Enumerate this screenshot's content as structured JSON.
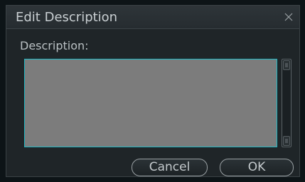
{
  "dialog": {
    "title": "Edit Description",
    "close_icon": "close-icon",
    "description_label": "Description:",
    "description_value": "",
    "cancel_label": "Cancel",
    "ok_label": "OK"
  },
  "colors": {
    "dialog_bg": "#1f2528",
    "textarea_bg": "#7c7c7c",
    "textarea_border": "#1fb7c3",
    "text": "#c9cfd2"
  }
}
